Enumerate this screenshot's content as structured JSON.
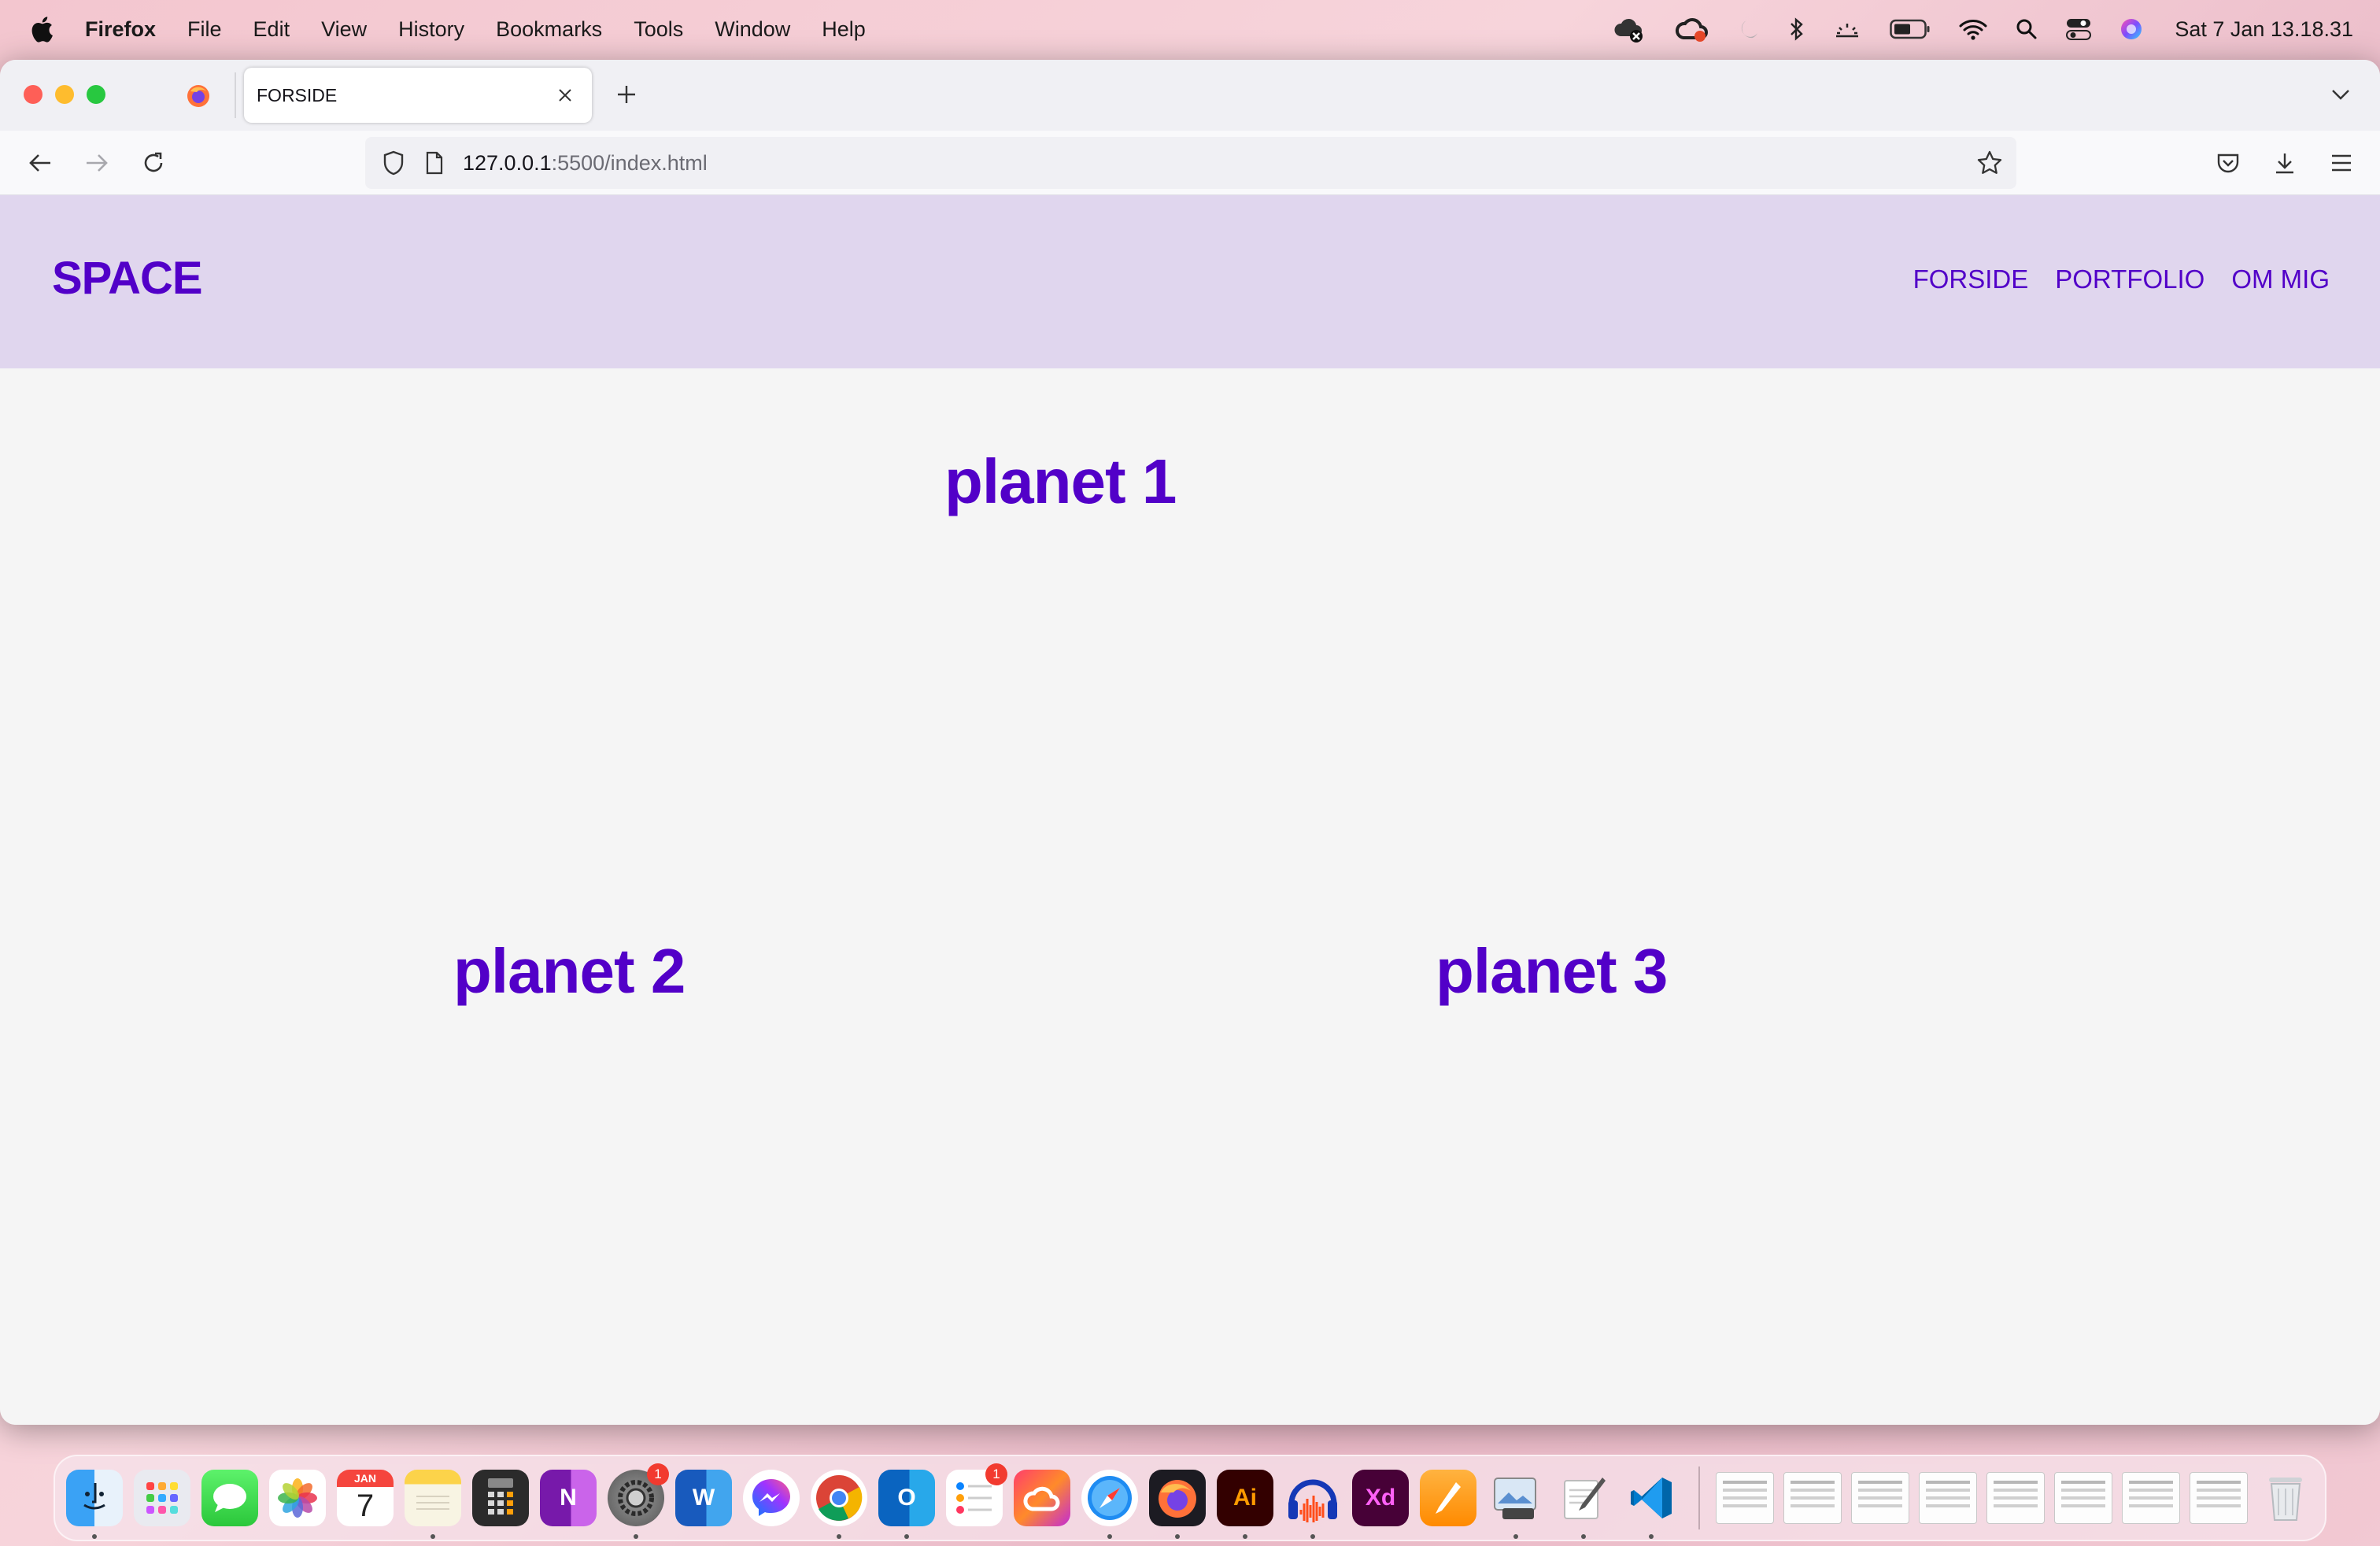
{
  "menubar": {
    "app_name": "Firefox",
    "items": [
      "File",
      "Edit",
      "View",
      "History",
      "Bookmarks",
      "Tools",
      "Window",
      "Help"
    ],
    "clock": "Sat 7 Jan  13.18.31"
  },
  "browser": {
    "tab_title": "FORSIDE",
    "url_host": "127.0.0.1",
    "url_rest": ":5500/index.html"
  },
  "page": {
    "logo": "SPACE",
    "nav": [
      "FORSIDE",
      "PORTFOLIO",
      "OM MIG"
    ],
    "planets": [
      "planet 1",
      "planet 2",
      "planet 3"
    ],
    "accent_color": "#5200c8",
    "header_bg": "#e0d6ee"
  },
  "dock": {
    "calendar": {
      "month": "JAN",
      "day": "7"
    },
    "apps": [
      {
        "name": "finder-icon"
      },
      {
        "name": "launchpad-icon"
      },
      {
        "name": "messages-icon"
      },
      {
        "name": "photos-icon"
      },
      {
        "name": "calendar-icon"
      },
      {
        "name": "notes-icon"
      },
      {
        "name": "calculator-icon"
      },
      {
        "name": "onenote-icon",
        "label": "N"
      },
      {
        "name": "system-settings-icon",
        "badge": "1"
      },
      {
        "name": "word-icon",
        "label": "W"
      },
      {
        "name": "messenger-icon"
      },
      {
        "name": "chrome-icon"
      },
      {
        "name": "outlook-icon",
        "label": "O"
      },
      {
        "name": "reminders-icon",
        "badge": "1"
      },
      {
        "name": "creative-cloud-icon"
      },
      {
        "name": "safari-icon"
      },
      {
        "name": "firefox-icon"
      },
      {
        "name": "illustrator-icon",
        "label": "Ai"
      },
      {
        "name": "audacity-icon"
      },
      {
        "name": "xd-icon",
        "label": "Xd"
      },
      {
        "name": "pages-icon"
      },
      {
        "name": "preview-icon"
      },
      {
        "name": "textedit-icon"
      },
      {
        "name": "vscode-icon"
      }
    ]
  }
}
